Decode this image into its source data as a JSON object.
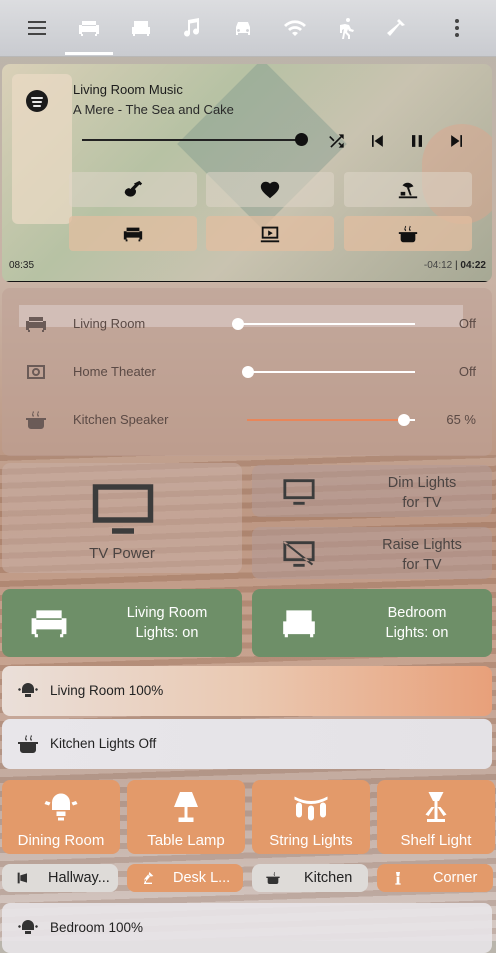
{
  "tabs": {
    "items": [
      "sofa-icon",
      "bed-icon",
      "music-icon",
      "car-icon",
      "wifi-icon",
      "walk-icon",
      "hammer-icon"
    ],
    "active": 0
  },
  "media": {
    "source_icon": "spotify-icon",
    "title": "Living Room Music",
    "artist": "A Mere - The Sea and Cake",
    "progress": 0.91,
    "elapsed": "08:35",
    "remaining": "-04:12",
    "separator": "|",
    "duration": "04:22",
    "controls": [
      "shuffle-icon",
      "previous-icon",
      "pause-icon",
      "next-icon"
    ],
    "buttons_row1": [
      "guitar-icon",
      "heart-icon",
      "beach-icon"
    ],
    "buttons_row2": [
      "sofa-icon",
      "theater-icon",
      "pot-icon"
    ]
  },
  "speakers": [
    {
      "name": "Living Room",
      "value": "Off",
      "level": 0.0,
      "icon": "sofa-icon"
    },
    {
      "name": "Home Theater",
      "value": "Off",
      "level": 0.0,
      "icon": "speaker-icon"
    },
    {
      "name": "Kitchen Speaker",
      "value": "65 %",
      "level": 0.65,
      "icon": "pot-icon"
    }
  ],
  "tv": {
    "power": "TV Power",
    "dim": [
      "Dim Lights",
      "for TV"
    ],
    "raise": [
      "Raise Lights",
      "for TV"
    ]
  },
  "lights": {
    "living": [
      "Living Room",
      "Lights: on"
    ],
    "bedroom": [
      "Bedroom",
      "Lights: on"
    ],
    "living_bar": "Living Room 100%",
    "kitchen_bar": "Kitchen Lights Off",
    "tiles": [
      "Dining Room",
      "Table Lamp",
      "String Lights",
      "Shelf Light"
    ],
    "pills": [
      "Hallway...",
      "Desk L...",
      "Kitchen",
      "Corner"
    ],
    "bedroom_bar": "Bedroom 100%"
  }
}
